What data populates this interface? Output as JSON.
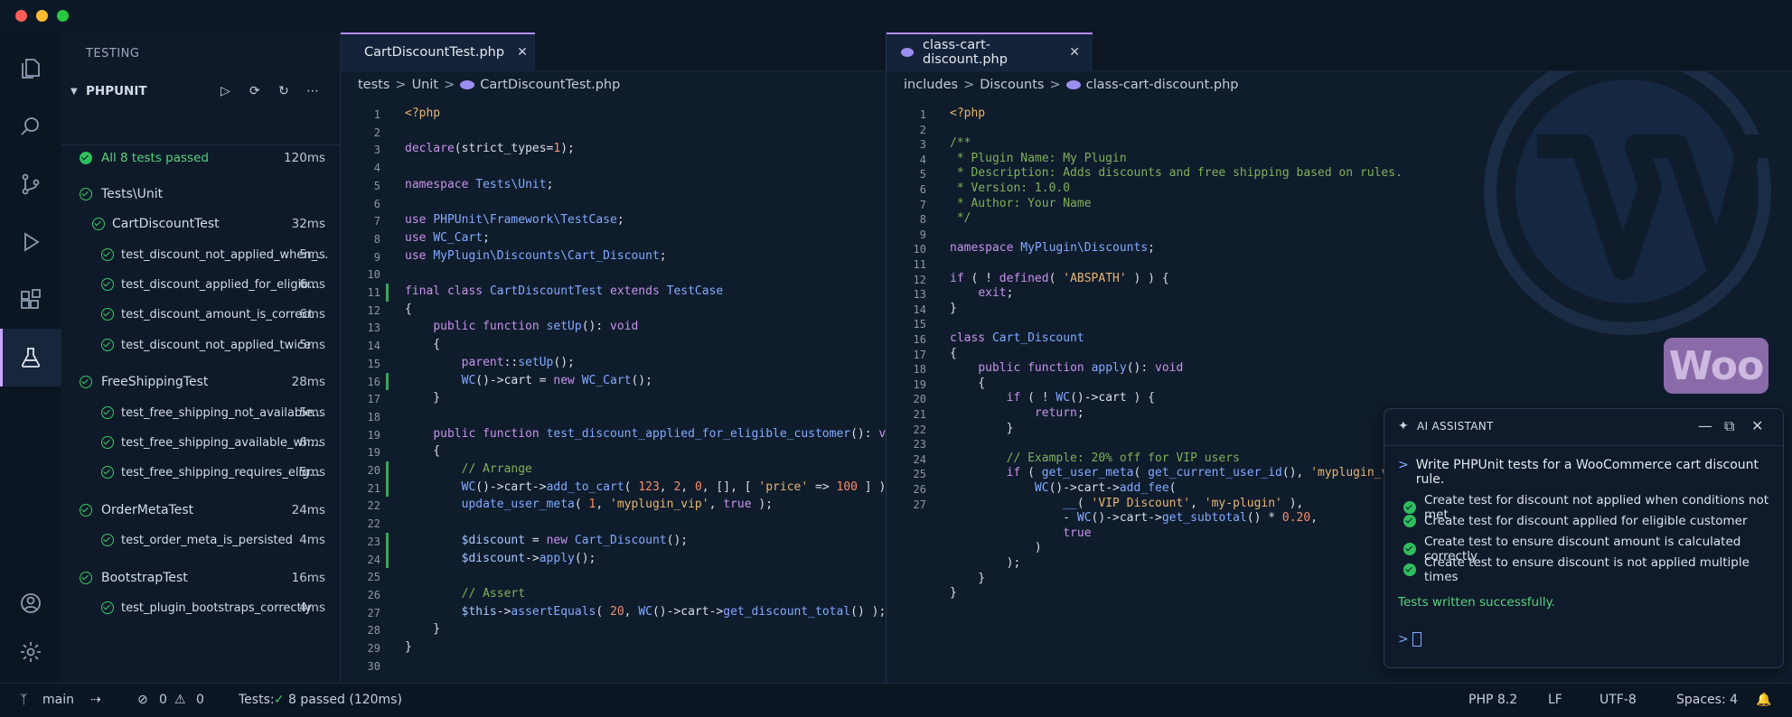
{
  "testing": {
    "title": "TESTING",
    "group": "PHPUNIT",
    "summary": {
      "label": "All 8 tests passed",
      "duration": "120ms"
    },
    "items": [
      {
        "label": "Tests\\Unit",
        "duration": "",
        "level": 0
      },
      {
        "label": "CartDiscountTest",
        "duration": "32ms",
        "level": 1
      },
      {
        "label": "test_discount_not_applied_when_...",
        "duration": "5ms",
        "level": 2
      },
      {
        "label": "test_discount_applied_for_eligib...",
        "duration": "6ms",
        "level": 2
      },
      {
        "label": "test_discount_amount_is_correct",
        "duration": "6ms",
        "level": 2
      },
      {
        "label": "test_discount_not_applied_twice",
        "duration": "5ms",
        "level": 2
      },
      {
        "label": "FreeShippingTest",
        "duration": "28ms",
        "level": 0
      },
      {
        "label": "test_free_shipping_not_available...",
        "duration": "5ms",
        "level": 2
      },
      {
        "label": "test_free_shipping_available_wh...",
        "duration": "6ms",
        "level": 2
      },
      {
        "label": "test_free_shipping_requires_elig...",
        "duration": "5ms",
        "level": 2
      },
      {
        "label": "OrderMetaTest",
        "duration": "24ms",
        "level": 0
      },
      {
        "label": "test_order_meta_is_persisted",
        "duration": "4ms",
        "level": 2
      },
      {
        "label": "BootstrapTest",
        "duration": "16ms",
        "level": 0
      },
      {
        "label": "test_plugin_bootstraps_correctly",
        "duration": "4ms",
        "level": 2
      }
    ]
  },
  "left_editor": {
    "tab": "CartDiscountTest.php",
    "crumbs": [
      "tests",
      "Unit",
      "CartDiscountTest.php"
    ],
    "line_numbers": [
      "1",
      "2",
      "3",
      "4",
      "5",
      "6",
      "7",
      "8",
      "9",
      "10",
      "11",
      "12",
      "13",
      "14",
      "15",
      "16",
      "17",
      "18",
      "19",
      "19",
      "20",
      "21",
      "22",
      "22",
      "23",
      "24",
      "25",
      "26",
      "27",
      "28",
      "29",
      "30"
    ],
    "lines": [
      "<?php",
      "",
      "declare(strict_types=1);",
      "",
      "namespace Tests\\Unit;",
      "",
      "use PHPUnit\\Framework\\TestCase;",
      "use WC_Cart;",
      "use MyPlugin\\Discounts\\Cart_Discount;",
      "",
      "final class CartDiscountTest extends TestCase",
      "{",
      "    public function setUp(): void",
      "    {",
      "        parent::setUp();",
      "        WC()->cart = new WC_Cart();",
      "    }",
      "",
      "    public function test_discount_applied_for_eligible_customer(): void",
      "    {",
      "        // Arrange",
      "        WC()->cart->add_to_cart( 123, 2, 0, [], [ 'price' => 100 ] );",
      "        update_user_meta( 1, 'myplugin_vip', true );",
      "",
      "        $discount = new Cart_Discount();",
      "        $discount->apply();",
      "",
      "        // Assert",
      "        $this->assertEquals( 20, WC()->cart->get_discount_total() );",
      "    }",
      "}",
      ""
    ]
  },
  "right_editor": {
    "tab": "class-cart-discount.php",
    "crumbs": [
      "includes",
      "Discounts",
      "class-cart-discount.php"
    ],
    "line_numbers": [
      "1",
      "2",
      "3",
      "4",
      "5",
      "6",
      "7",
      "8",
      "9",
      "10",
      "11",
      "12",
      "13",
      "14",
      "15",
      "16",
      "17",
      "18",
      "19",
      "20",
      "21",
      "22",
      "23",
      "24",
      "25",
      "26",
      "27"
    ],
    "lines": [
      "<?php",
      "",
      "/**",
      " * Plugin Name: My Plugin",
      " * Description: Adds discounts and free shipping based on rules.",
      " * Version: 1.0.0",
      " * Author: Your Name",
      " */",
      "",
      "namespace MyPlugin\\Discounts;",
      "",
      "if ( ! defined( 'ABSPATH' ) ) {",
      "    exit;",
      "}",
      "",
      "class Cart_Discount",
      "{",
      "    public function apply(): void",
      "    {",
      "        if ( ! WC()->cart ) {",
      "            return;",
      "        }",
      "",
      "        // Example: 20% off for VIP users",
      "        if ( get_user_meta( get_current_user_id(), 'myplugin_vip',",
      "            WC()->cart->add_fee(",
      "                __( 'VIP Discount', 'my-plugin' ),",
      "                - WC()->cart->get_subtotal() * 0.20,",
      "                true",
      "            )",
      "        );",
      "    }",
      "}",
      ""
    ]
  },
  "ai": {
    "title": "AI ASSISTANT",
    "prompt": "Write PHPUnit tests for a WooCommerce cart discount rule.",
    "items": [
      "Create test for discount not applied when conditions not met",
      "Create test for discount applied for eligible customer",
      "Create test to ensure discount amount is calculated correctly",
      "Create test to ensure discount is not applied multiple times"
    ],
    "result": "Tests written successfully."
  },
  "status": {
    "branch": "main",
    "errors": "0",
    "warnings": "0",
    "tests_label": "Tests:",
    "tests_result": "8 passed (120ms)",
    "php": "PHP 8.2",
    "eol": "LF",
    "encoding": "UTF-8",
    "spaces": "Spaces: 4"
  },
  "brand": {
    "woo": "Woo"
  },
  "colors": {
    "accent": "#b48cff",
    "success": "#3dc76a",
    "background": "#0f1b2b"
  }
}
